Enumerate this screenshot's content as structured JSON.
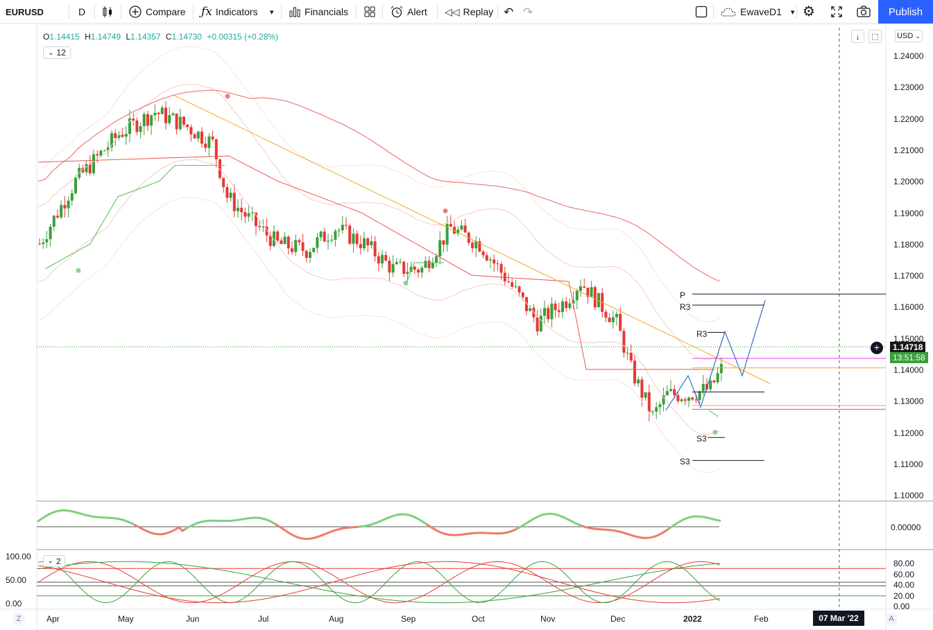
{
  "toolbar": {
    "symbol": "EURUSD",
    "interval": "D",
    "compare": "Compare",
    "indicators": "Indicators",
    "financials": "Financials",
    "alert": "Alert",
    "replay": "Replay",
    "layout_name": "EwaveD1",
    "publish": "Publish"
  },
  "legend": {
    "o_label": "O",
    "open": "1.14415",
    "h_label": "H",
    "high": "1.14749",
    "l_label": "L",
    "low": "1.14357",
    "c_label": "C",
    "close": "1.14730",
    "change": "+0.00315 (+0.28%)",
    "collapsed_count": "12",
    "pane3_count": "2"
  },
  "currency": "USD",
  "price_axis": [
    "1.24000",
    "1.23000",
    "1.22000",
    "1.21000",
    "1.20000",
    "1.19000",
    "1.18000",
    "1.17000",
    "1.16000",
    "1.15000",
    "1.14000",
    "1.13000",
    "1.12000",
    "1.11000",
    "1.10000"
  ],
  "last_price": "1.14718",
  "countdown": "13:51:58",
  "pane2_axis": [
    "0.00000"
  ],
  "pane3_axis": [
    "80.00",
    "60.00",
    "40.00",
    "20.00",
    "0.00"
  ],
  "pane3_left_axis": [
    "100.00",
    "50.00",
    "0.00"
  ],
  "time_axis": [
    "Apr",
    "May",
    "Jun",
    "Jul",
    "Aug",
    "Sep",
    "Oct",
    "Nov",
    "Dec",
    "2022",
    "Feb"
  ],
  "cursor_date": "07 Mar '22",
  "pivot_labels": {
    "p": "P",
    "r3_upper": "R3",
    "r3_lower": "R3",
    "s3_upper": "S3",
    "s3_lower": "S3"
  },
  "bottom_left": "Z",
  "bottom_right": "A",
  "colors": {
    "up": "#26a69a",
    "bull": "#3a9e3a",
    "bear": "#e53935",
    "accent": "#2962ff",
    "trend": "#f5a623"
  },
  "icons": [
    "candles-icon",
    "compare-plus-icon",
    "fx-indicators-icon",
    "financials-icon",
    "layouts-icon",
    "alert-icon",
    "replay-icon",
    "undo-icon",
    "redo-icon",
    "fullscreen-box-icon",
    "cloud-icon",
    "settings-icon",
    "fullscreen-icon",
    "camera-icon"
  ]
}
